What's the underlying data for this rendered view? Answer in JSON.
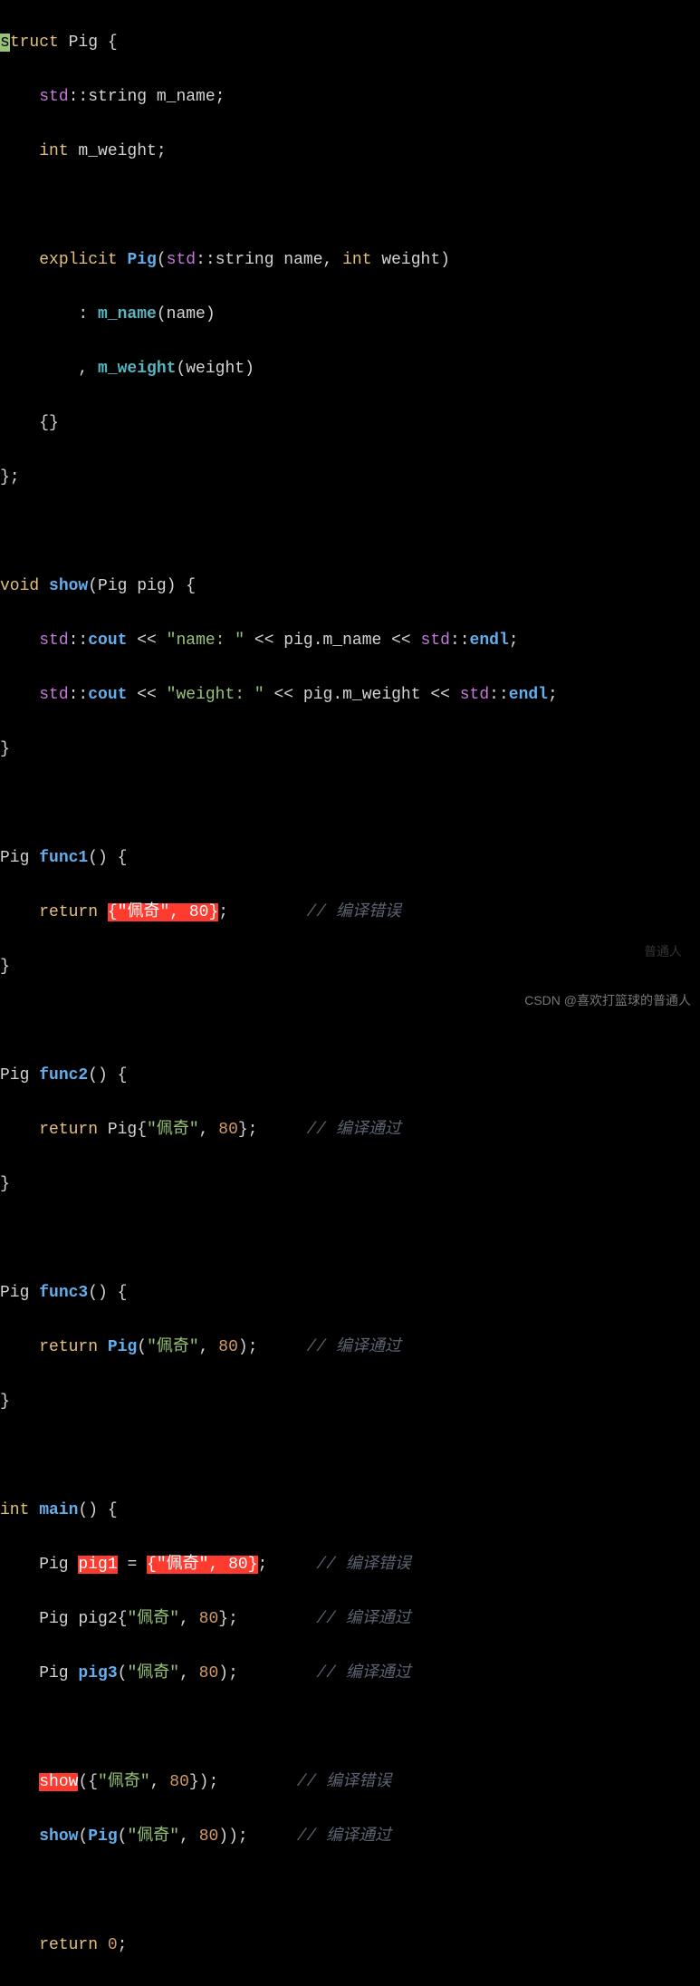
{
  "code": {
    "struct_kw": "struct",
    "struct_name": " Pig {",
    "field1_pre": "    ",
    "field1_ns": "std",
    "field1_dcolon": "::",
    "field1_type": "string",
    "field1_name": " m_name;",
    "field2_pre": "    ",
    "field2_type": "int",
    "field2_name": " m_weight;",
    "blank": "",
    "ctor_pre": "    ",
    "explicit_kw": "explicit",
    "ctor_name": " Pig",
    "ctor_params_open": "(",
    "ctor_p1_ns": "std",
    "ctor_p1_dcolon": "::",
    "ctor_p1_type": "string",
    "ctor_p1_name": " name, ",
    "ctor_p2_type": "int",
    "ctor_p2_name": " weight)",
    "init1_pre": "        : ",
    "init1_mem": "m_name",
    "init1_args": "(name)",
    "init2_pre": "        , ",
    "init2_mem": "m_weight",
    "init2_args": "(weight)",
    "ctor_body": "    {}",
    "struct_close": "};",
    "show_void": "void",
    "show_name": " show",
    "show_params": "(Pig pig) {",
    "cout1_pre": "    ",
    "cout1_ns": "std",
    "cout1_dcolon": "::",
    "cout1_cout": "cout",
    "cout1_op1": " << ",
    "cout1_str": "\"name: \"",
    "cout1_op2": " << pig.m_name << ",
    "cout1_ns2": "std",
    "cout1_dcolon2": "::",
    "cout1_endl": "endl",
    "cout1_semi": ";",
    "cout2_pre": "    ",
    "cout2_ns": "std",
    "cout2_dcolon": "::",
    "cout2_cout": "cout",
    "cout2_op1": " << ",
    "cout2_str": "\"weight: \"",
    "cout2_op2": " << pig.m_weight << ",
    "cout2_ns2": "std",
    "cout2_dcolon2": "::",
    "cout2_endl": "endl",
    "cout2_semi": ";",
    "show_close": "}",
    "func1_ret": "Pig ",
    "func1_name": "func1",
    "func1_params": "() {",
    "func1_body_pre": "    ",
    "return_kw": "return",
    "func1_sp": " ",
    "func1_brace_open": "{",
    "func1_str": "\"佩奇\"",
    "func1_comma": ", ",
    "func1_num": "80",
    "func1_brace_close": "}",
    "func1_semi": ";",
    "func1_pad": "        ",
    "cmt_err": "// 编译错误",
    "cmt_ok": "// 编译通过",
    "func_close": "}",
    "func2_name": "func2",
    "func2_body": " Pig{",
    "func2_str": "\"佩奇\"",
    "func2_comma": ", ",
    "func2_num": "80",
    "func2_close": "};",
    "func2_pad": "     ",
    "func3_name": "func3",
    "func3_body_open": " ",
    "func3_pig": "Pig",
    "func3_paren_open": "(",
    "func3_str": "\"佩奇\"",
    "func3_comma": ", ",
    "func3_num": "80",
    "func3_close": ");",
    "func3_pad": "     ",
    "main_int": "int",
    "main_name": " main",
    "main_params": "() {",
    "pig1_pre": "    Pig ",
    "pig1_var": "pig1",
    "pig1_eq": " = ",
    "pig1_brace_open": "{",
    "pig1_str": "\"佩奇\"",
    "pig1_comma": ", ",
    "pig1_num": "80",
    "pig1_brace_close": "}",
    "pig1_semi": ";",
    "pig1_pad": "     ",
    "pig2_line_pre": "    Pig pig2{",
    "pig2_str": "\"佩奇\"",
    "pig2_comma": ", ",
    "pig2_num": "80",
    "pig2_close": "};",
    "pig2_pad": "        ",
    "pig3_line_pre": "    Pig ",
    "pig3_ctor": "pig3",
    "pig3_paren_open": "(",
    "pig3_str": "\"佩奇\"",
    "pig3_comma": ", ",
    "pig3_num": "80",
    "pig3_close": ");",
    "pig3_pad": "        ",
    "show1_pre": "    ",
    "show1_fn": "show",
    "show1_args_open": "({",
    "show1_str": "\"佩奇\"",
    "show1_comma": ", ",
    "show1_num": "80",
    "show1_close": "});",
    "show1_pad": "        ",
    "show2_pre": "    ",
    "show2_fn": "show",
    "show2_paren_open": "(",
    "show2_pig": "Pig",
    "show2_inner_open": "(",
    "show2_str": "\"佩奇\"",
    "show2_comma": ", ",
    "show2_num": "80",
    "show2_close": "));",
    "show2_pad": "     ",
    "ret0_pre": "    ",
    "ret0_num": " 0",
    "ret0_semi": ";",
    "s_char": "s"
  },
  "watermark": "CSDN @喜欢打篮球的普通人",
  "faint_mark": "普通人"
}
